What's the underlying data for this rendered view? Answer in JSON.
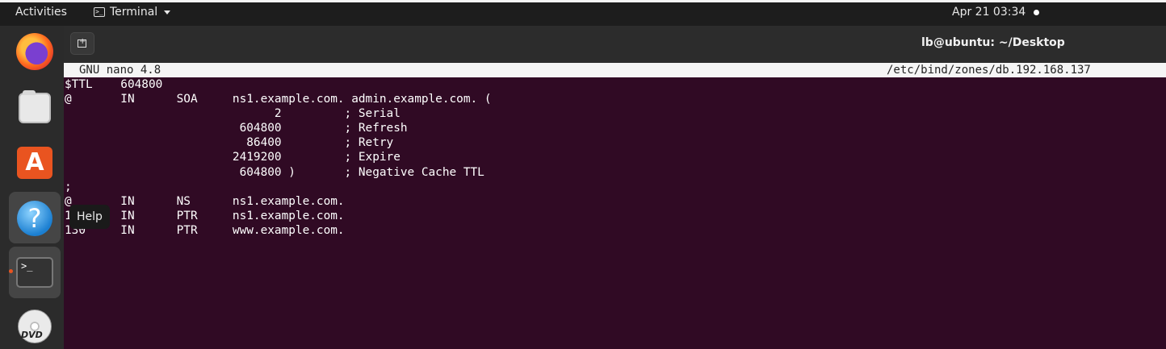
{
  "topbar": {
    "activities": "Activities",
    "app_menu": "Terminal",
    "clock": "Apr 21  03:34"
  },
  "dock": {
    "tooltip": "Help",
    "apps": [
      {
        "icon": "firefox-icon"
      },
      {
        "icon": "files-icon"
      },
      {
        "icon": "software-store-icon"
      },
      {
        "icon": "help-icon"
      },
      {
        "icon": "terminal-icon",
        "running": true
      },
      {
        "icon": "dvd-icon"
      }
    ],
    "dvd_label": "DVD"
  },
  "window": {
    "title": "lb@ubuntu: ~/Desktop"
  },
  "nano": {
    "version": "GNU nano 4.8",
    "file_path": "/etc/bind/zones/db.192.168.137"
  },
  "editor": {
    "lines": [
      "$TTL    604800",
      "@       IN      SOA     ns1.example.com. admin.example.com. (",
      "                              2         ; Serial",
      "                         604800         ; Refresh",
      "                          86400         ; Retry",
      "                        2419200         ; Expire",
      "                         604800 )       ; Negative Cache TTL",
      ";",
      "@       IN      NS      ns1.example.com.",
      "1       IN      PTR     ns1.example.com.",
      "130     IN      PTR     www.example.com."
    ]
  },
  "colors": {
    "terminal_bg": "#300a24",
    "accent": "#e95420"
  }
}
